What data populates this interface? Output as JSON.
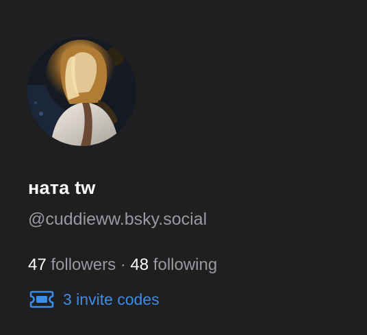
{
  "profile": {
    "display_name": "ната tw",
    "handle": "@cuddieww.bsky.social",
    "followers_count": "47",
    "followers_label": "followers",
    "separator": "·",
    "following_count": "48",
    "following_label": "following"
  },
  "invite": {
    "icon": "ticket-icon",
    "label": "3 invite codes",
    "color": "#3d8ce8"
  },
  "colors": {
    "background": "#1f1e20",
    "primary_text": "#ffffff",
    "secondary_text": "#9a9a9f",
    "accent": "#3d8ce8"
  }
}
